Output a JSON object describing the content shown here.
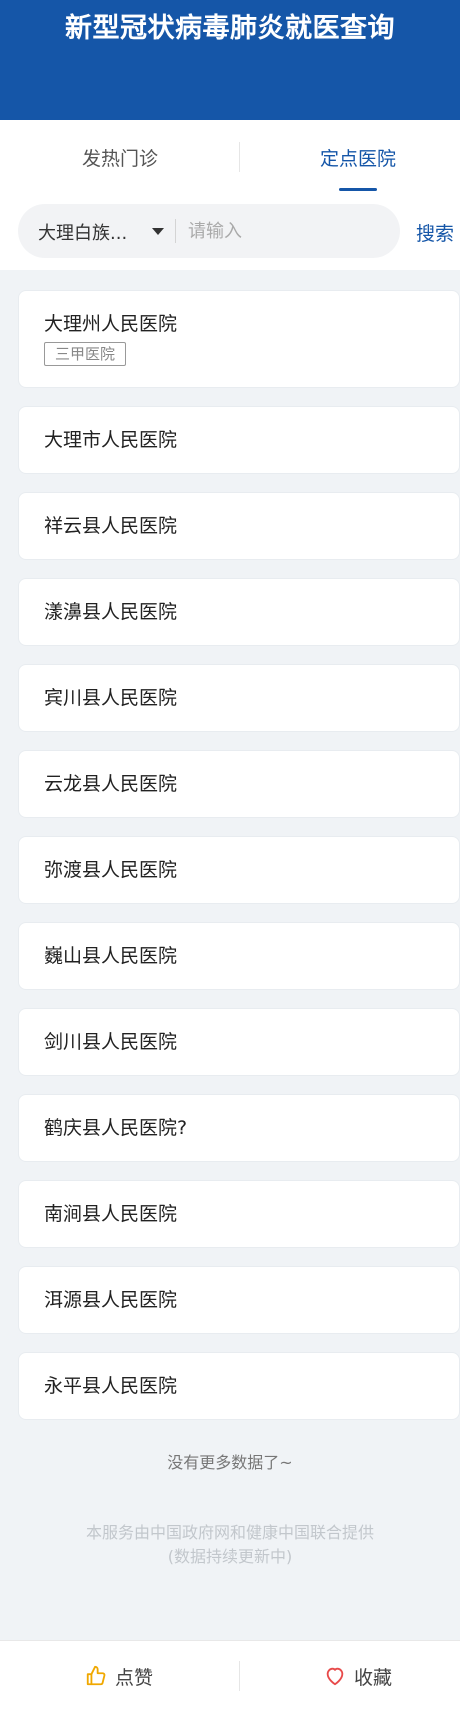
{
  "header": {
    "title": "新型冠状病毒肺炎就医查询"
  },
  "tabs": [
    {
      "label": "发热门诊"
    },
    {
      "label": "定点医院"
    }
  ],
  "search": {
    "region": "大理白族...",
    "placeholder": "请输入",
    "value": "",
    "button_label": "搜索"
  },
  "hospitals": [
    {
      "name": "大理州人民医院",
      "tag": "三甲医院"
    },
    {
      "name": "大理市人民医院"
    },
    {
      "name": "祥云县人民医院"
    },
    {
      "name": "漾濞县人民医院"
    },
    {
      "name": "宾川县人民医院"
    },
    {
      "name": "云龙县人民医院"
    },
    {
      "name": "弥渡县人民医院"
    },
    {
      "name": "巍山县人民医院"
    },
    {
      "name": "剑川县人民医院"
    },
    {
      "name": "鹤庆县人民医院?"
    },
    {
      "name": "南涧县人民医院"
    },
    {
      "name": "洱源县人民医院"
    },
    {
      "name": "永平县人民医院"
    }
  ],
  "list_end_text": "没有更多数据了~",
  "footer_note": {
    "line1": "本服务由中国政府网和健康中国联合提供",
    "line2": "(数据持续更新中)"
  },
  "bottom_bar": {
    "like_label": "点赞",
    "favorite_label": "收藏",
    "like_icon": "thumbs-up-icon",
    "favorite_icon": "heart-icon"
  },
  "colors": {
    "brand": "#1556a8",
    "like_icon": "#f0a800",
    "favorite_icon": "#e84a4a"
  }
}
